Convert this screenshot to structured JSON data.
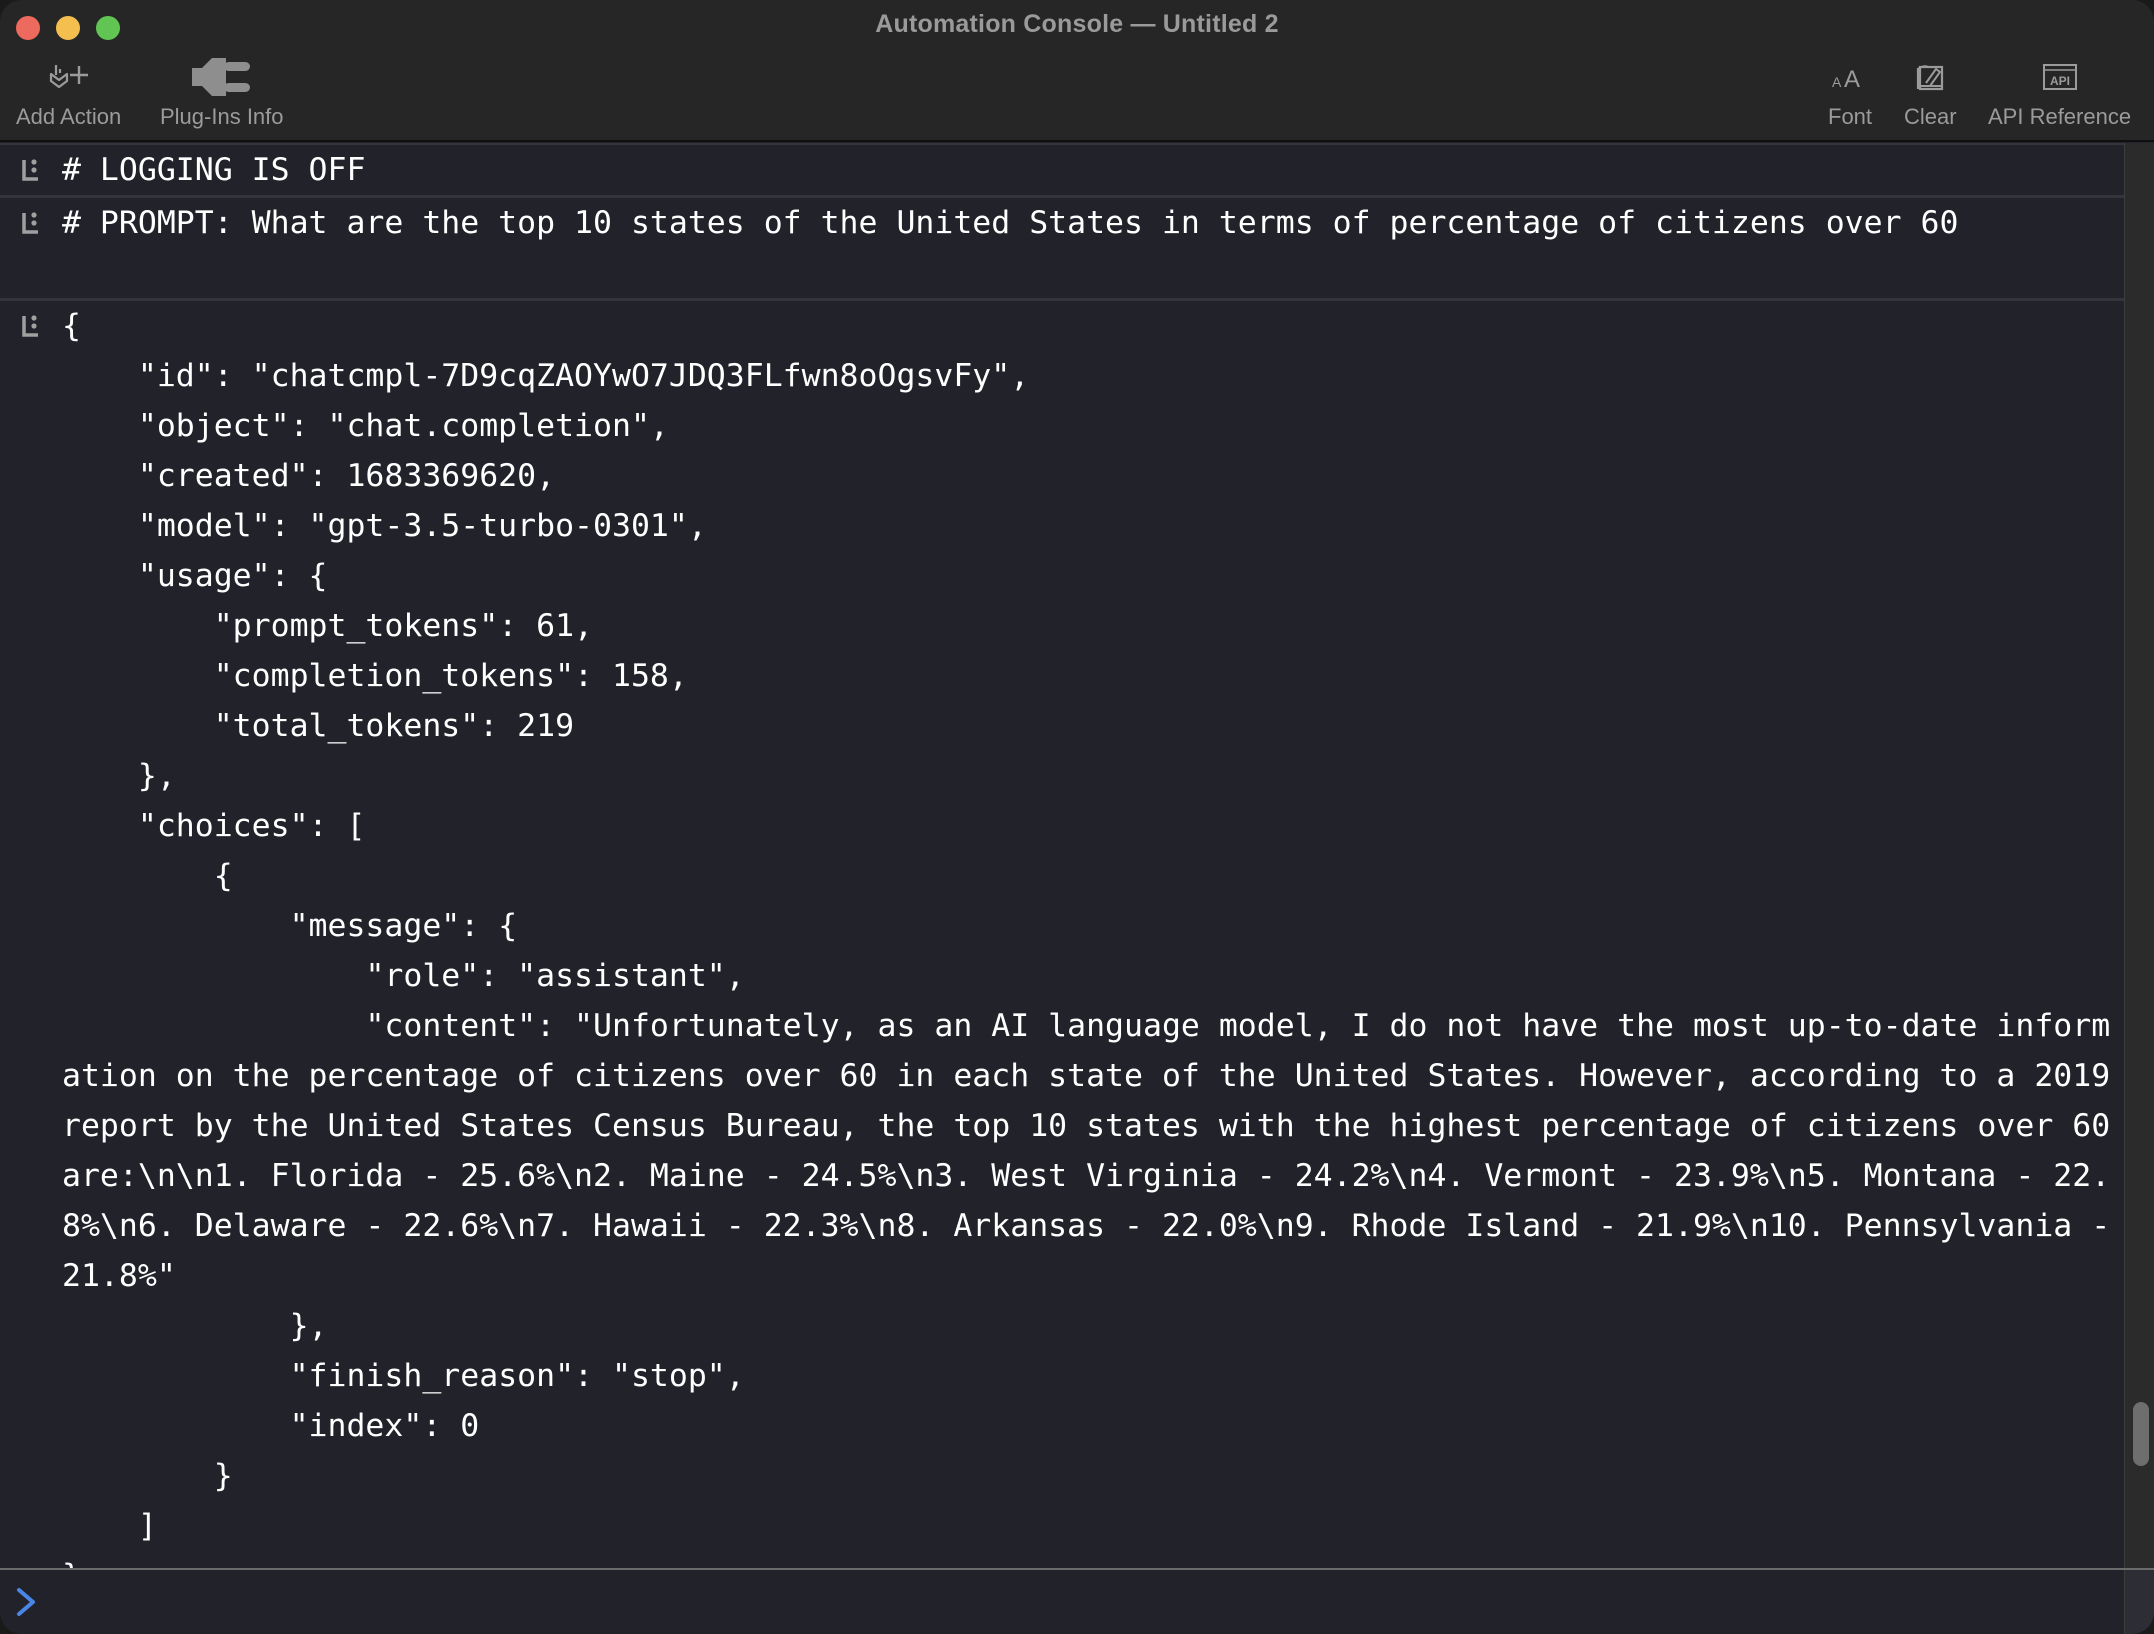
{
  "window": {
    "title": "Automation Console — Untitled 2",
    "traffic_lights": [
      "close",
      "minimize",
      "zoom"
    ]
  },
  "toolbar": {
    "left": [
      {
        "label": "Add Action",
        "icon": "add-action-icon"
      },
      {
        "label": "Plug-Ins Info",
        "icon": "plug-icon"
      }
    ],
    "right": [
      {
        "label": "Font",
        "icon": "font-size-icon"
      },
      {
        "label": "Clear",
        "icon": "clear-icon"
      },
      {
        "label": "API Reference",
        "icon": "api-icon"
      }
    ]
  },
  "console": {
    "entries": [
      {
        "lines": [
          "# LOGGING IS OFF"
        ]
      },
      {
        "lines": [
          "# PROMPT: What are the top 10 states of the United States in terms of percentage of citizens over 60",
          ""
        ]
      },
      {
        "lines": [
          "{",
          "    \"id\": \"chatcmpl-7D9cqZAOYwO7JDQ3FLfwn8oOgsvFy\",",
          "    \"object\": \"chat.completion\",",
          "    \"created\": 1683369620,",
          "    \"model\": \"gpt-3.5-turbo-0301\",",
          "    \"usage\": {",
          "        \"prompt_tokens\": 61,",
          "        \"completion_tokens\": 158,",
          "        \"total_tokens\": 219",
          "    },",
          "    \"choices\": [",
          "        {",
          "            \"message\": {",
          "                \"role\": \"assistant\",",
          "                \"content\": \"Unfortunately, as an AI language model, I do not have the most up-to-date information on the percentage of citizens over 60 in each state of the United States. However, according to a 2019 report by the United States Census Bureau, the top 10 states with the highest percentage of citizens over 60 are:\\n\\n1. Florida - 25.6%\\n2. Maine - 24.5%\\n3. West Virginia - 24.2%\\n4. Vermont - 23.9%\\n5. Montana - 22.8%\\n6. Delaware - 22.6%\\n7. Hawaii - 22.3%\\n8. Arkansas - 22.0%\\n9. Rhode Island - 21.9%\\n10. Pennsylvania - 21.8%\"",
          "            },",
          "            \"finish_reason\": \"stop\",",
          "            \"index\": 0",
          "        }",
          "    ]",
          "}"
        ]
      }
    ]
  },
  "input": {
    "prompt_symbol": ">",
    "value": "",
    "placeholder": ""
  },
  "scrollbar": {
    "position_fraction": 0.93
  },
  "colors": {
    "console_bg": "#21222a",
    "titlebar_bg": "#262626",
    "text": "#ffffff",
    "label_gray": "#9b9b9b",
    "prompt_blue": "#4a86e8",
    "close": "#ec6a5e",
    "minimize": "#f4bf4f",
    "zoom": "#61c554"
  }
}
